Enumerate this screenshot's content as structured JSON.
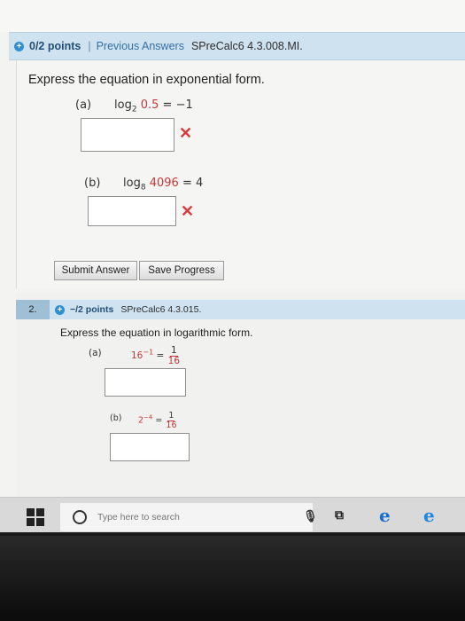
{
  "question1": {
    "points": "0/2 points",
    "separator": "|",
    "previous_answers": "Previous Answers",
    "question_id": "SPreCalc6 4.3.008.MI.",
    "prompt": "Express the equation in exponential form.",
    "part_a": {
      "label": "(a)",
      "log_word": "log",
      "base": "2",
      "argument": "0.5",
      "equals": "=",
      "result": "−1",
      "answer_value": "",
      "status_icon": "x-mark"
    },
    "part_b": {
      "label": "(b)",
      "log_word": "log",
      "base": "8",
      "argument": "4096",
      "equals": "=",
      "result": "4",
      "answer_value": "",
      "status_icon": "x-mark"
    },
    "buttons": {
      "submit": "Submit Answer",
      "save": "Save Progress"
    }
  },
  "question2": {
    "number": "2.",
    "points": "−/2 points",
    "question_id": "SPreCalc6 4.3.015.",
    "prompt": "Express the equation in logarithmic form.",
    "part_a": {
      "label": "(a)",
      "base": "16",
      "exponent": "−1",
      "equals": "=",
      "numerator": "1",
      "denominator": "16",
      "answer_value": ""
    },
    "part_b": {
      "label": "(b)",
      "base": "2",
      "exponent": "−4",
      "equals": "=",
      "numerator": "1",
      "denominator": "16",
      "answer_value": ""
    }
  },
  "taskbar": {
    "search_placeholder": "Type here to search",
    "icons": [
      "windows-start-icon",
      "cortana-icon",
      "microphone-icon",
      "task-view-icon",
      "edge-icon",
      "ie-icon"
    ]
  },
  "colors": {
    "header_blue": "#cfe2ef",
    "link_blue": "#3470a8",
    "error_red": "#d93a3a",
    "math_red": "#c43a3a"
  }
}
